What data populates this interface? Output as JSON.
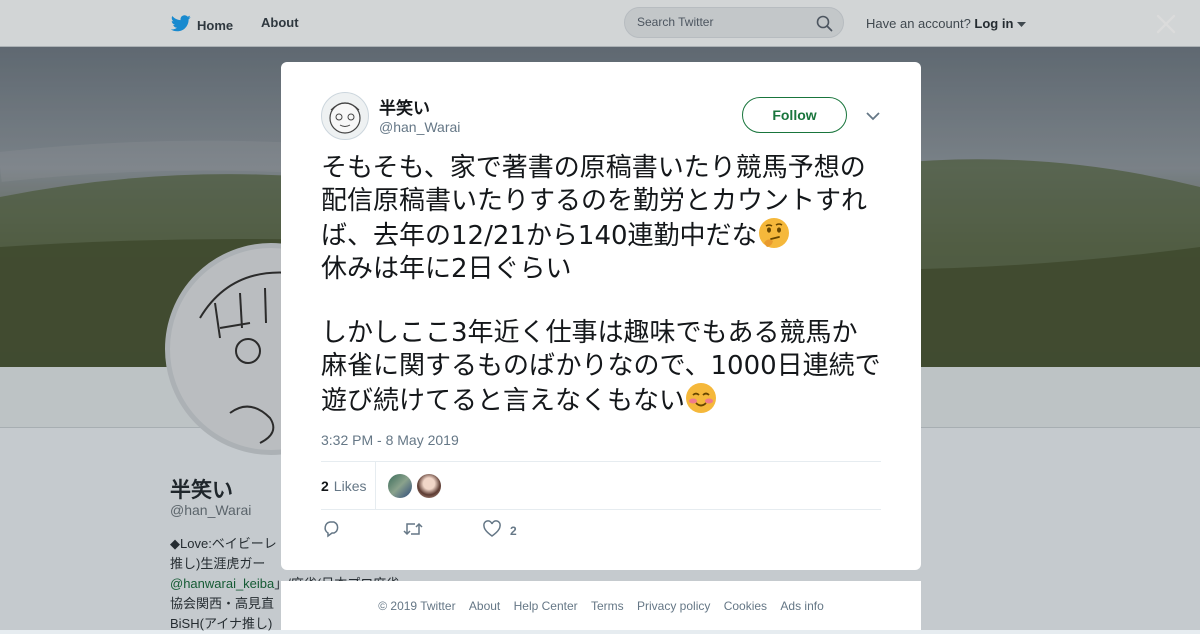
{
  "nav": {
    "home_label": "Home",
    "about_label": "About",
    "search_placeholder": "Search Twitter",
    "have_account_text": "Have an account?",
    "login_label": "Log in"
  },
  "background_profile": {
    "name": "半笑い",
    "handle": "@han_Warai",
    "bio_lines": [
      "◆Love:ベイビーレ",
      "推し)生涯虎ガー",
      "@hanwarai_keiba」/麻雀(日本プロ麻雀",
      "協会関西・高見直",
      "BiSH(アイナ推し)"
    ],
    "bio_link": "@hanwarai_keiba"
  },
  "tweet": {
    "author_name": "半笑い",
    "author_handle": "@han_Warai",
    "follow_label": "Follow",
    "paragraph1": "そもそも、家で著書の原稿書いたり競馬予想の配信原稿書いたりするのを勤労とカウントすれば、去年の12/21から140連勤中だな",
    "paragraph1_line2": "休みは年に2日ぐらい",
    "paragraph2": "しかしここ3年近く仕事は趣味でもある競馬か麻雀に関するものばかりなので、1000日連続で遊び続けてると言えなくもない",
    "timestamp": "3:32 PM - 8 May 2019",
    "likes_count": "2",
    "likes_label": "Likes",
    "action_like_count": "2",
    "emoji_1": "thinking-face",
    "emoji_2": "smiling-face-blushing"
  },
  "footer": {
    "copyright": "© 2019 Twitter",
    "about": "About",
    "help_center": "Help Center",
    "terms": "Terms",
    "privacy_policy": "Privacy policy",
    "cookies": "Cookies",
    "ads_info": "Ads info"
  },
  "colors": {
    "follow_green": "#19753c",
    "twitter_blue": "#1da1f2",
    "link_green": "#1a6b3e"
  }
}
